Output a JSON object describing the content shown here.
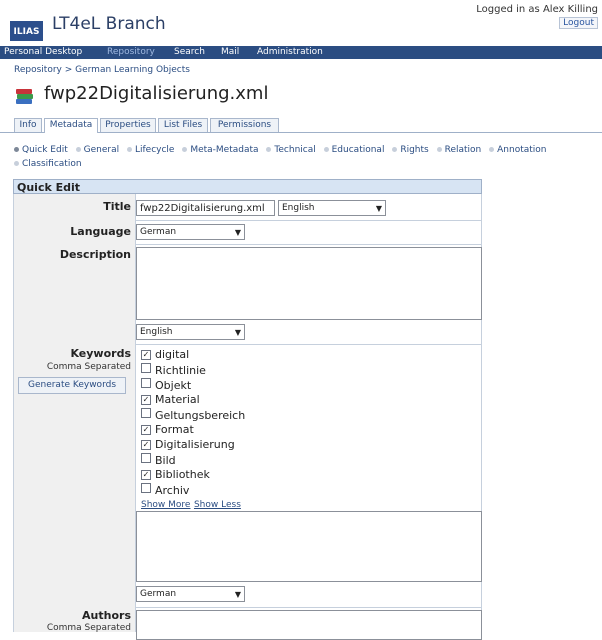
{
  "header": {
    "app_title": "LT4eL Branch",
    "logo": "ILIAS",
    "logged_in": "Logged in as Alex Killing",
    "logout": "Logout"
  },
  "mainmenu": [
    "Personal Desktop",
    "Repository",
    "Search",
    "Mail",
    "Administration"
  ],
  "breadcrumb": "Repository > German Learning Objects",
  "page_title": "fwp22Digitalisierung.xml",
  "tabs": [
    "Info",
    "Metadata",
    "Properties",
    "List Files",
    "Permissions"
  ],
  "subtabs": [
    "Quick Edit",
    "General",
    "Lifecycle",
    "Meta-Metadata",
    "Technical",
    "Educational",
    "Rights",
    "Relation",
    "Annotation",
    "Classification"
  ],
  "form": {
    "header": "Quick Edit",
    "title_label": "Title",
    "title_value": "fwp22Digitalisierung.xml",
    "title_lang": "English",
    "language_label": "Language",
    "language_value": "German",
    "description_label": "Description",
    "description_lang": "English",
    "keywords_label": "Keywords",
    "keywords_sub": "Comma Separated",
    "generate_button": "Generate Keywords",
    "keywords": [
      {
        "text": "digital",
        "checked": true
      },
      {
        "text": "Richtlinie",
        "checked": false
      },
      {
        "text": "Objekt",
        "checked": false
      },
      {
        "text": "Material",
        "checked": true
      },
      {
        "text": "Geltungsbereich",
        "checked": false
      },
      {
        "text": "Format",
        "checked": true
      },
      {
        "text": "Digitalisierung",
        "checked": true
      },
      {
        "text": "Bild",
        "checked": false
      },
      {
        "text": "Bibliothek",
        "checked": true
      },
      {
        "text": "Archiv",
        "checked": false
      }
    ],
    "show_more": "Show More",
    "show_less": "Show Less",
    "keywords_lang": "German",
    "authors_label": "Authors",
    "authors_sub": "Comma Separated"
  }
}
